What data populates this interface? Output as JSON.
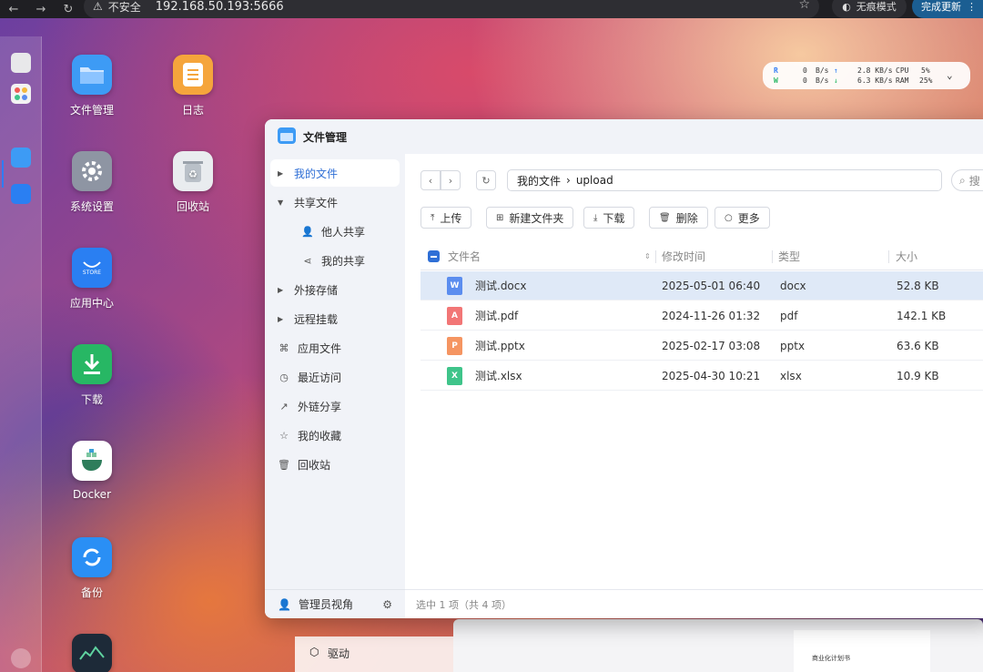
{
  "browser": {
    "back": "←",
    "forward": "→",
    "reload": "↻",
    "security_warning": "不安全",
    "url": "192.168.50.193:5666",
    "incognito_label": "无痕模式",
    "update_label": "完成更新"
  },
  "stats": {
    "read_label": "R",
    "write_label": "W",
    "disk_read_value": "0",
    "disk_read_unit": "B/s",
    "disk_write_value": "0",
    "disk_write_unit": "B/s",
    "net_up": "2.8 KB/s",
    "net_down": "6.3 KB/s",
    "cpu_label": "CPU",
    "cpu_value": "5%",
    "ram_label": "RAM",
    "ram_value": "25%"
  },
  "desktop_icons": [
    {
      "label": "文件管理",
      "color": "#3d9bf5"
    },
    {
      "label": "日志",
      "color": "#f5a53c"
    },
    {
      "label": "系统设置",
      "color": "#8e95a3"
    },
    {
      "label": "回收站",
      "color": "#e9ecef"
    },
    {
      "label": "应用中心",
      "color": "#2a7ff2"
    },
    {
      "label": "下载",
      "color": "#27b764"
    },
    {
      "label": "Docker",
      "color": "#ffffff"
    },
    {
      "label": "备份",
      "color": "#2a8ff5"
    }
  ],
  "store_badge": "STORE",
  "window": {
    "title": "文件管理"
  },
  "sidebar": {
    "items": [
      {
        "label": "我的文件"
      },
      {
        "label": "共享文件"
      },
      {
        "label": "他人共享"
      },
      {
        "label": "我的共享"
      },
      {
        "label": "外接存储"
      },
      {
        "label": "远程挂载"
      },
      {
        "label": "应用文件"
      },
      {
        "label": "最近访问"
      },
      {
        "label": "外链分享"
      },
      {
        "label": "我的收藏"
      },
      {
        "label": "回收站"
      }
    ],
    "footer_label": "管理员视角"
  },
  "breadcrumb": {
    "root": "我的文件",
    "separator": "›",
    "current": "upload"
  },
  "search": {
    "placeholder": "搜"
  },
  "toolbar": {
    "upload": "上传",
    "new_folder": "新建文件夹",
    "download": "下载",
    "delete": "删除",
    "more": "更多"
  },
  "table": {
    "headers": [
      "文件名",
      "修改时间",
      "类型",
      "大小"
    ],
    "rows": [
      {
        "name": "测试.docx",
        "modified": "2025-05-01 06:40",
        "type": "docx",
        "size": "52.8 KB",
        "icon_color": "#5b8def",
        "icon_glyph": "W"
      },
      {
        "name": "测试.pdf",
        "modified": "2024-11-26 01:32",
        "type": "pdf",
        "size": "142.1 KB",
        "icon_color": "#f27676",
        "icon_glyph": "A"
      },
      {
        "name": "测试.pptx",
        "modified": "2025-02-17 03:08",
        "type": "pptx",
        "size": "63.6 KB",
        "icon_color": "#f59562",
        "icon_glyph": "P"
      },
      {
        "name": "测试.xlsx",
        "modified": "2025-04-30 10:21",
        "type": "xlsx",
        "size": "10.9 KB",
        "icon_color": "#3fc48a",
        "icon_glyph": "X"
      }
    ]
  },
  "status": {
    "text": "选中 1 项（共 4 项）"
  },
  "behind": {
    "drive_label": "驱动",
    "doc_caption": "商业化计划书"
  }
}
